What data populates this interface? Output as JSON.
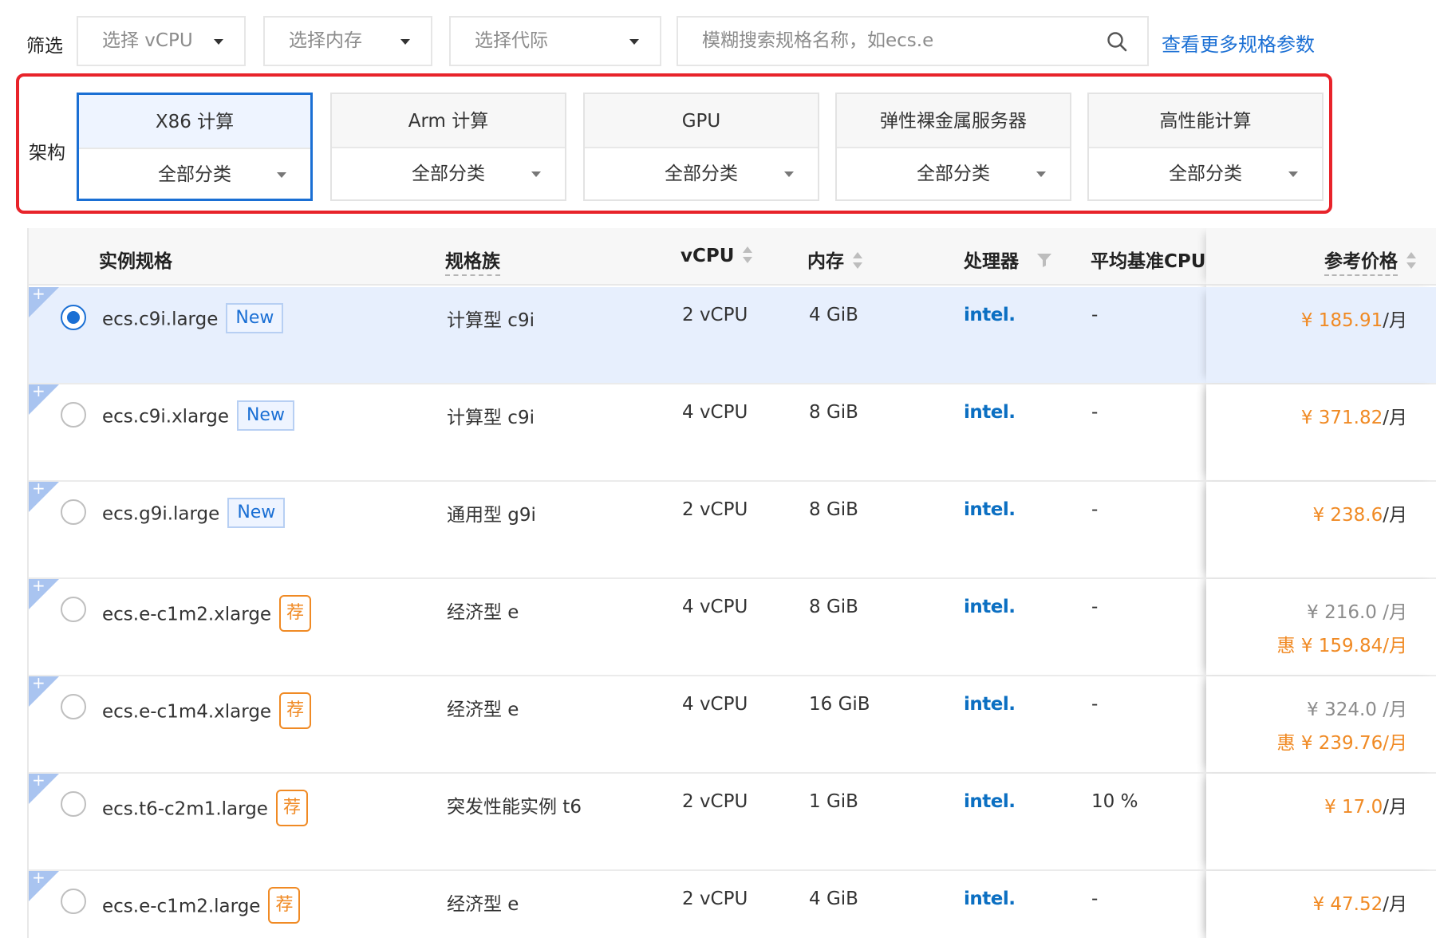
{
  "filter": {
    "label": "筛选",
    "vcpu_placeholder": "选择 vCPU",
    "memory_placeholder": "选择内存",
    "generation_placeholder": "选择代际",
    "search_placeholder": "模糊搜索规格名称，如ecs.e",
    "more_link": "查看更多规格参数"
  },
  "arch": {
    "label": "架构",
    "cards": [
      {
        "name": "X86 计算",
        "category": "全部分类"
      },
      {
        "name": "Arm 计算",
        "category": "全部分类"
      },
      {
        "name": "GPU",
        "category": "全部分类"
      },
      {
        "name": "弹性裸金属服务器",
        "category": "全部分类"
      },
      {
        "name": "高性能计算",
        "category": "全部分类"
      }
    ],
    "active_index": 0,
    "highlight_color": "#e8232a"
  },
  "table": {
    "headers": {
      "spec": "实例规格",
      "family": "规格族",
      "vcpu": "vCPU",
      "memory": "内存",
      "processor": "处理器",
      "baseline": "平均基准CPU",
      "price": "参考价格"
    },
    "processor_logo": "intel.",
    "rows": [
      {
        "spec": "ecs.c9i.large",
        "badge": "New",
        "family": "计算型 c9i",
        "vcpu": "2 vCPU",
        "memory": "4 GiB",
        "baseline": "-",
        "price": "¥ 185.91",
        "unit": "/月",
        "selected": true
      },
      {
        "spec": "ecs.c9i.xlarge",
        "badge": "New",
        "family": "计算型 c9i",
        "vcpu": "4 vCPU",
        "memory": "8 GiB",
        "baseline": "-",
        "price": "¥ 371.82",
        "unit": "/月"
      },
      {
        "spec": "ecs.g9i.large",
        "badge": "New",
        "family": "通用型 g9i",
        "vcpu": "2 vCPU",
        "memory": "8 GiB",
        "baseline": "-",
        "price": "¥ 238.6",
        "unit": "/月"
      },
      {
        "spec": "ecs.e-c1m2.xlarge",
        "badge": "荐",
        "family": "经济型 e",
        "vcpu": "4 vCPU",
        "memory": "8 GiB",
        "baseline": "-",
        "orig_price": "¥ 216.0 /月",
        "disc_price": "惠 ¥ 159.84/月"
      },
      {
        "spec": "ecs.e-c1m4.xlarge",
        "badge": "荐",
        "family": "经济型 e",
        "vcpu": "4 vCPU",
        "memory": "16 GiB",
        "baseline": "-",
        "orig_price": "¥ 324.0 /月",
        "disc_price": "惠 ¥ 239.76/月"
      },
      {
        "spec": "ecs.t6-c2m1.large",
        "badge": "荐",
        "family": "突发性能实例 t6",
        "vcpu": "2 vCPU",
        "memory": "1 GiB",
        "baseline": "10 %",
        "price": "¥ 17.0",
        "unit": "/月"
      },
      {
        "spec": "ecs.e-c1m2.large",
        "badge": "荐",
        "family": "经济型 e",
        "vcpu": "2 vCPU",
        "memory": "4 GiB",
        "baseline": "-",
        "price": "¥ 47.52",
        "unit": "/月"
      }
    ]
  },
  "colors": {
    "accent": "#1a6fd4",
    "price": "#f08a24",
    "intel": "#0b6fc2"
  }
}
